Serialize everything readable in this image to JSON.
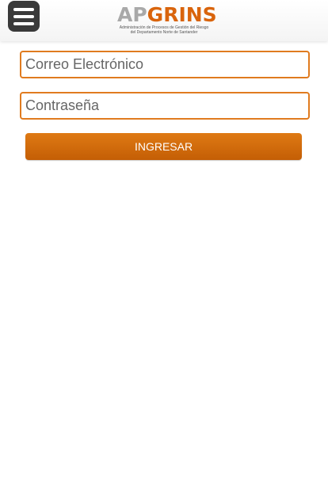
{
  "header": {
    "menu_icon": "hamburger-menu-icon",
    "logo": {
      "part1": "AP",
      "part2": "GRINS",
      "subtitle_line1": "Administración de Procesos de Gestión del Riesgo",
      "subtitle_line2": "del Departamento Norte de Santander"
    }
  },
  "form": {
    "email_placeholder": "Correo Electrónico",
    "email_value": "",
    "password_placeholder": "Contraseña",
    "password_value": "",
    "submit_label": "INGRESAR"
  },
  "colors": {
    "accent": "#d9640c",
    "menu_button": "#3a3a3a",
    "logo_gray": "#a9a9a9"
  }
}
